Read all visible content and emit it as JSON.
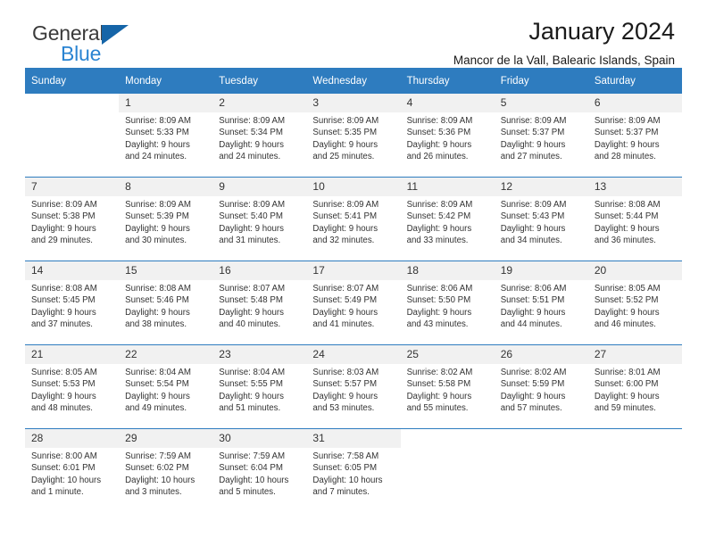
{
  "brand": {
    "name_part1": "General",
    "name_part2": "Blue",
    "triangle_color": "#1565a8",
    "blue_color": "#2a84d2"
  },
  "header": {
    "title": "January 2024",
    "location": "Mancor de la Vall, Balearic Islands, Spain",
    "header_bg": "#2e7cbf",
    "daynum_bg": "#f1f1f1"
  },
  "weekdays": [
    "Sunday",
    "Monday",
    "Tuesday",
    "Wednesday",
    "Thursday",
    "Friday",
    "Saturday"
  ],
  "weeks": [
    {
      "days": [
        {
          "num": "",
          "sunrise": "",
          "sunset": "",
          "daylight_1": "",
          "daylight_2": ""
        },
        {
          "num": "1",
          "sunrise": "Sunrise: 8:09 AM",
          "sunset": "Sunset: 5:33 PM",
          "daylight_1": "Daylight: 9 hours",
          "daylight_2": "and 24 minutes."
        },
        {
          "num": "2",
          "sunrise": "Sunrise: 8:09 AM",
          "sunset": "Sunset: 5:34 PM",
          "daylight_1": "Daylight: 9 hours",
          "daylight_2": "and 24 minutes."
        },
        {
          "num": "3",
          "sunrise": "Sunrise: 8:09 AM",
          "sunset": "Sunset: 5:35 PM",
          "daylight_1": "Daylight: 9 hours",
          "daylight_2": "and 25 minutes."
        },
        {
          "num": "4",
          "sunrise": "Sunrise: 8:09 AM",
          "sunset": "Sunset: 5:36 PM",
          "daylight_1": "Daylight: 9 hours",
          "daylight_2": "and 26 minutes."
        },
        {
          "num": "5",
          "sunrise": "Sunrise: 8:09 AM",
          "sunset": "Sunset: 5:37 PM",
          "daylight_1": "Daylight: 9 hours",
          "daylight_2": "and 27 minutes."
        },
        {
          "num": "6",
          "sunrise": "Sunrise: 8:09 AM",
          "sunset": "Sunset: 5:37 PM",
          "daylight_1": "Daylight: 9 hours",
          "daylight_2": "and 28 minutes."
        }
      ]
    },
    {
      "days": [
        {
          "num": "7",
          "sunrise": "Sunrise: 8:09 AM",
          "sunset": "Sunset: 5:38 PM",
          "daylight_1": "Daylight: 9 hours",
          "daylight_2": "and 29 minutes."
        },
        {
          "num": "8",
          "sunrise": "Sunrise: 8:09 AM",
          "sunset": "Sunset: 5:39 PM",
          "daylight_1": "Daylight: 9 hours",
          "daylight_2": "and 30 minutes."
        },
        {
          "num": "9",
          "sunrise": "Sunrise: 8:09 AM",
          "sunset": "Sunset: 5:40 PM",
          "daylight_1": "Daylight: 9 hours",
          "daylight_2": "and 31 minutes."
        },
        {
          "num": "10",
          "sunrise": "Sunrise: 8:09 AM",
          "sunset": "Sunset: 5:41 PM",
          "daylight_1": "Daylight: 9 hours",
          "daylight_2": "and 32 minutes."
        },
        {
          "num": "11",
          "sunrise": "Sunrise: 8:09 AM",
          "sunset": "Sunset: 5:42 PM",
          "daylight_1": "Daylight: 9 hours",
          "daylight_2": "and 33 minutes."
        },
        {
          "num": "12",
          "sunrise": "Sunrise: 8:09 AM",
          "sunset": "Sunset: 5:43 PM",
          "daylight_1": "Daylight: 9 hours",
          "daylight_2": "and 34 minutes."
        },
        {
          "num": "13",
          "sunrise": "Sunrise: 8:08 AM",
          "sunset": "Sunset: 5:44 PM",
          "daylight_1": "Daylight: 9 hours",
          "daylight_2": "and 36 minutes."
        }
      ]
    },
    {
      "days": [
        {
          "num": "14",
          "sunrise": "Sunrise: 8:08 AM",
          "sunset": "Sunset: 5:45 PM",
          "daylight_1": "Daylight: 9 hours",
          "daylight_2": "and 37 minutes."
        },
        {
          "num": "15",
          "sunrise": "Sunrise: 8:08 AM",
          "sunset": "Sunset: 5:46 PM",
          "daylight_1": "Daylight: 9 hours",
          "daylight_2": "and 38 minutes."
        },
        {
          "num": "16",
          "sunrise": "Sunrise: 8:07 AM",
          "sunset": "Sunset: 5:48 PM",
          "daylight_1": "Daylight: 9 hours",
          "daylight_2": "and 40 minutes."
        },
        {
          "num": "17",
          "sunrise": "Sunrise: 8:07 AM",
          "sunset": "Sunset: 5:49 PM",
          "daylight_1": "Daylight: 9 hours",
          "daylight_2": "and 41 minutes."
        },
        {
          "num": "18",
          "sunrise": "Sunrise: 8:06 AM",
          "sunset": "Sunset: 5:50 PM",
          "daylight_1": "Daylight: 9 hours",
          "daylight_2": "and 43 minutes."
        },
        {
          "num": "19",
          "sunrise": "Sunrise: 8:06 AM",
          "sunset": "Sunset: 5:51 PM",
          "daylight_1": "Daylight: 9 hours",
          "daylight_2": "and 44 minutes."
        },
        {
          "num": "20",
          "sunrise": "Sunrise: 8:05 AM",
          "sunset": "Sunset: 5:52 PM",
          "daylight_1": "Daylight: 9 hours",
          "daylight_2": "and 46 minutes."
        }
      ]
    },
    {
      "days": [
        {
          "num": "21",
          "sunrise": "Sunrise: 8:05 AM",
          "sunset": "Sunset: 5:53 PM",
          "daylight_1": "Daylight: 9 hours",
          "daylight_2": "and 48 minutes."
        },
        {
          "num": "22",
          "sunrise": "Sunrise: 8:04 AM",
          "sunset": "Sunset: 5:54 PM",
          "daylight_1": "Daylight: 9 hours",
          "daylight_2": "and 49 minutes."
        },
        {
          "num": "23",
          "sunrise": "Sunrise: 8:04 AM",
          "sunset": "Sunset: 5:55 PM",
          "daylight_1": "Daylight: 9 hours",
          "daylight_2": "and 51 minutes."
        },
        {
          "num": "24",
          "sunrise": "Sunrise: 8:03 AM",
          "sunset": "Sunset: 5:57 PM",
          "daylight_1": "Daylight: 9 hours",
          "daylight_2": "and 53 minutes."
        },
        {
          "num": "25",
          "sunrise": "Sunrise: 8:02 AM",
          "sunset": "Sunset: 5:58 PM",
          "daylight_1": "Daylight: 9 hours",
          "daylight_2": "and 55 minutes."
        },
        {
          "num": "26",
          "sunrise": "Sunrise: 8:02 AM",
          "sunset": "Sunset: 5:59 PM",
          "daylight_1": "Daylight: 9 hours",
          "daylight_2": "and 57 minutes."
        },
        {
          "num": "27",
          "sunrise": "Sunrise: 8:01 AM",
          "sunset": "Sunset: 6:00 PM",
          "daylight_1": "Daylight: 9 hours",
          "daylight_2": "and 59 minutes."
        }
      ]
    },
    {
      "days": [
        {
          "num": "28",
          "sunrise": "Sunrise: 8:00 AM",
          "sunset": "Sunset: 6:01 PM",
          "daylight_1": "Daylight: 10 hours",
          "daylight_2": "and 1 minute."
        },
        {
          "num": "29",
          "sunrise": "Sunrise: 7:59 AM",
          "sunset": "Sunset: 6:02 PM",
          "daylight_1": "Daylight: 10 hours",
          "daylight_2": "and 3 minutes."
        },
        {
          "num": "30",
          "sunrise": "Sunrise: 7:59 AM",
          "sunset": "Sunset: 6:04 PM",
          "daylight_1": "Daylight: 10 hours",
          "daylight_2": "and 5 minutes."
        },
        {
          "num": "31",
          "sunrise": "Sunrise: 7:58 AM",
          "sunset": "Sunset: 6:05 PM",
          "daylight_1": "Daylight: 10 hours",
          "daylight_2": "and 7 minutes."
        },
        {
          "num": "",
          "sunrise": "",
          "sunset": "",
          "daylight_1": "",
          "daylight_2": ""
        },
        {
          "num": "",
          "sunrise": "",
          "sunset": "",
          "daylight_1": "",
          "daylight_2": ""
        },
        {
          "num": "",
          "sunrise": "",
          "sunset": "",
          "daylight_1": "",
          "daylight_2": ""
        }
      ]
    }
  ]
}
